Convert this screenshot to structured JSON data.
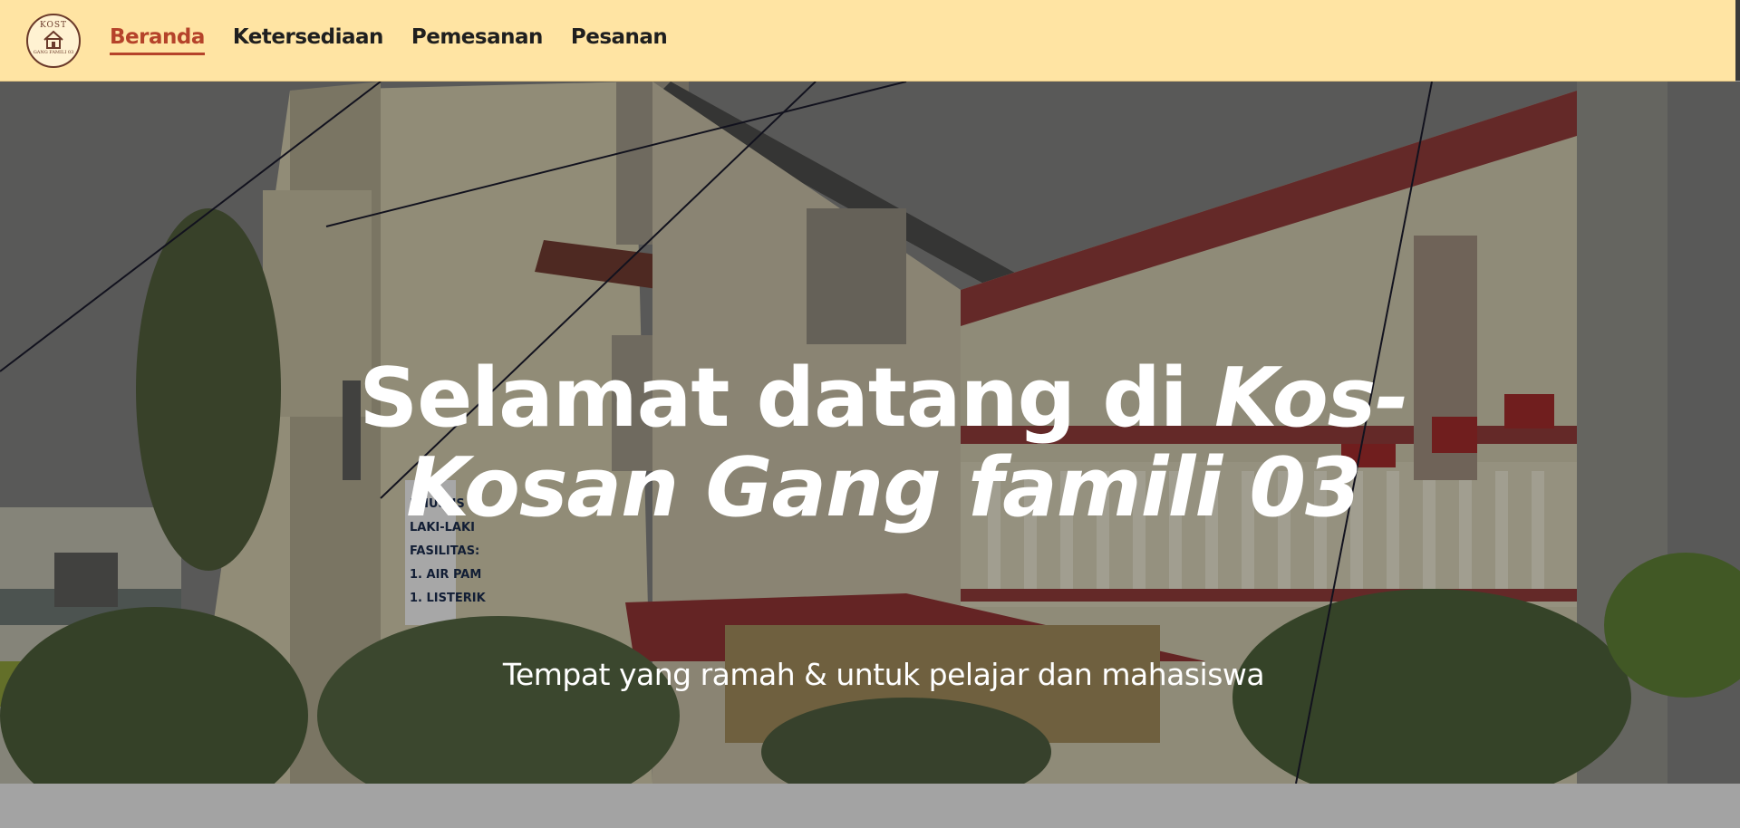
{
  "nav": {
    "logo": {
      "top_text": "KOST",
      "bottom_text": "GANG FAMILI 03"
    },
    "items": [
      {
        "label": "Beranda",
        "active": true
      },
      {
        "label": "Ketersediaan",
        "active": false
      },
      {
        "label": "Pemesanan",
        "active": false
      },
      {
        "label": "Pesanan",
        "active": false
      }
    ]
  },
  "hero": {
    "title_prefix": "Selamat datang di ",
    "title_emphasis": "Kos-Kosan Gang famili 03",
    "subtitle": "Tempat yang ramah & untuk pelajar dan mahasiswa",
    "sign_text": [
      "KHUSUS",
      "LAKI-LAKI",
      "FASILITAS:",
      "1. AIR PAM",
      "1. LISTERIK"
    ]
  },
  "colors": {
    "navbar_bg": "#ffe4a3",
    "active_link": "#b5432a",
    "link": "#1f1f1f"
  }
}
